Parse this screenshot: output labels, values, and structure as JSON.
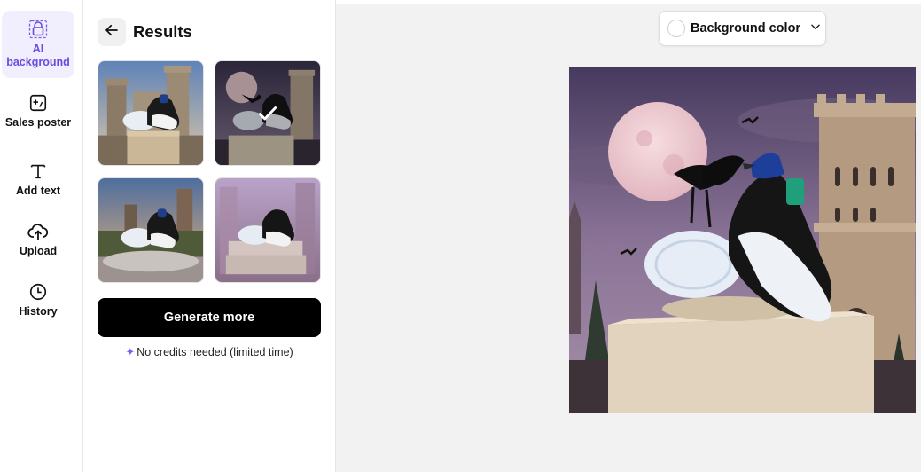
{
  "sidebar": {
    "items": [
      {
        "label": "AI background",
        "icon": "bag-icon",
        "active": true
      },
      {
        "label": "Sales poster",
        "icon": "poster-icon",
        "active": false
      },
      {
        "label": "Add text",
        "icon": "text-icon",
        "active": false
      },
      {
        "label": "Upload",
        "icon": "upload-icon",
        "active": false
      },
      {
        "label": "History",
        "icon": "clock-icon",
        "active": false
      }
    ]
  },
  "panel": {
    "title": "Results",
    "results": [
      {
        "scene": "castle daylight",
        "selected": false
      },
      {
        "scene": "moon night raven",
        "selected": true
      },
      {
        "scene": "castle sunset",
        "selected": false
      },
      {
        "scene": "blurred purple castle",
        "selected": false
      }
    ],
    "generate_label": "Generate more",
    "credits_note": "No credits needed (limited time)"
  },
  "canvas": {
    "background_color_label": "Background color"
  },
  "colors": {
    "accent": "#6a4bdc",
    "active_bg": "#f1eefe",
    "button": "#000000"
  }
}
